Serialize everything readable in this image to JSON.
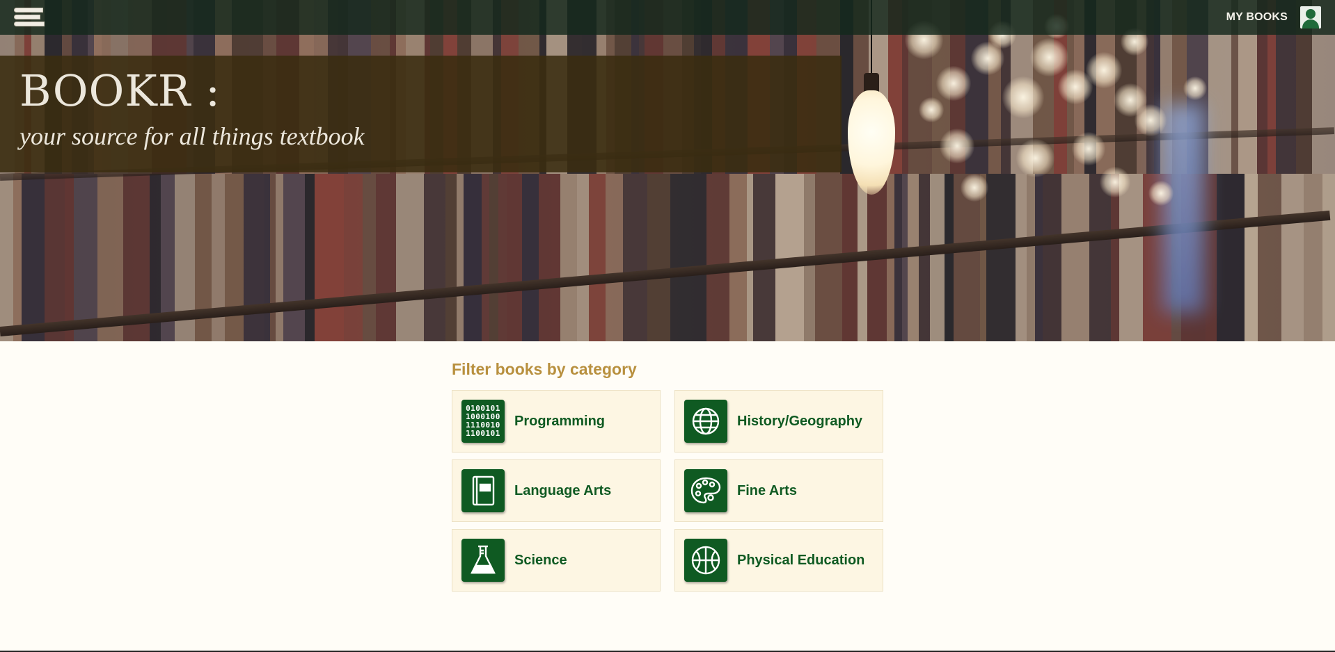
{
  "topbar": {
    "my_books_label": "MY BOOKS"
  },
  "banner": {
    "title": "BOOKR :",
    "tagline": "your source for all things textbook"
  },
  "filter": {
    "heading": "Filter books by category",
    "categories": [
      {
        "label": "Programming",
        "icon": "binary-code-icon",
        "binary": [
          "0100101",
          "1000100",
          "1110010",
          "1100101"
        ]
      },
      {
        "label": "History/Geography",
        "icon": "globe-icon"
      },
      {
        "label": "Language Arts",
        "icon": "notebook-icon"
      },
      {
        "label": "Fine Arts",
        "icon": "palette-icon"
      },
      {
        "label": "Science",
        "icon": "flask-icon"
      },
      {
        "label": "Physical Education",
        "icon": "basketball-icon"
      }
    ]
  },
  "colors": {
    "accent_green": "#0f5a22",
    "heading_gold": "#b8903e",
    "card_bg": "#fdf6e3",
    "page_bg": "#fffdf7"
  }
}
